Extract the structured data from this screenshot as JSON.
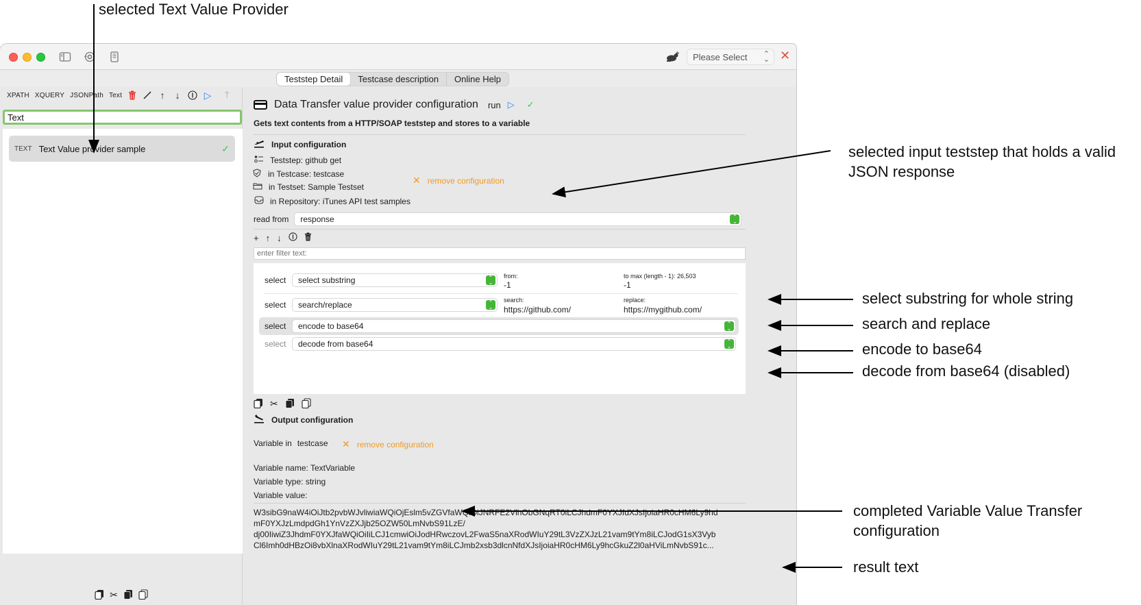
{
  "annotations": {
    "top_label": "selected Text Value Provider",
    "input_teststep": [
      "selected input teststep that holds a valid",
      "JSON response"
    ],
    "substring": "select substring for  whole string",
    "search_replace": "search and replace",
    "encode": "encode to base64",
    "decode": "decode from base64 (disabled)",
    "completed": [
      "completed Variable Value Transfer",
      "configuration"
    ],
    "result": "result text"
  },
  "window": {
    "toolbar_icons": [
      "sidebar-toggle-icon",
      "sync-settings-icon",
      "notes-icon"
    ],
    "environment_select": {
      "value": "Please Select"
    },
    "close_label": "✕"
  },
  "tabs": [
    {
      "label": "Teststep Detail",
      "active": true
    },
    {
      "label": "Testcase description",
      "active": false
    },
    {
      "label": "Online Help",
      "active": false
    }
  ],
  "sidebar": {
    "toolbar": {
      "types": [
        "XPATH",
        "XQUERY",
        "JSONPath",
        "Text"
      ],
      "icons": [
        "trash-icon",
        "edit-icon",
        "arrow-up-icon",
        "arrow-down-icon",
        "info-icon",
        "play-icon",
        "pin-icon"
      ]
    },
    "filter_value": "Text",
    "items": [
      {
        "kind": "TEXT",
        "name": "Text Value provider sample",
        "status": "✓"
      }
    ],
    "bottom_icons": [
      "copy-icon",
      "cut-icon",
      "paste-icon",
      "duplicate-icon"
    ]
  },
  "main": {
    "title": "Data Transfer value provider configuration",
    "run_label": "run",
    "play_glyph": "▷",
    "status_glyph": "✓",
    "subtitle": "Gets text contents from a HTTP/SOAP teststep and stores to a variable",
    "input_section": {
      "heading": "Input configuration",
      "teststep": "Teststep: github get",
      "testcase": "in Testcase: testcase",
      "testset": "in Testset: Sample Testset",
      "repository": "in Repository: iTunes API test samples",
      "remove_label": "remove configuration"
    },
    "read_from": {
      "label": "read from",
      "value": "response"
    },
    "filter_placeholder": "enter filter text:",
    "operations": [
      {
        "label": "select",
        "value": "select substring",
        "field1_label": "from:",
        "field1_value": "-1",
        "field2_label": "to max (length - 1): 26,503",
        "field2_value": "-1",
        "disabled": false
      },
      {
        "label": "select",
        "value": "search/replace",
        "field1_label": "search:",
        "field1_value": "https://github.com/",
        "field2_label": "replace:",
        "field2_value": "https://mygithub.com/",
        "disabled": false
      },
      {
        "label": "select",
        "value": "encode to base64",
        "disabled": false,
        "selected": true
      },
      {
        "label": "select",
        "value": "decode from base64",
        "disabled": true
      }
    ],
    "output_section": {
      "heading": "Output configuration",
      "variable_in_label": "Variable in",
      "variable_in_value": "testcase",
      "remove_label": "remove configuration",
      "variable_name": "Variable name: TextVariable",
      "variable_type": "Variable type: string",
      "variable_value_label": "Variable value:",
      "result_lines": [
        "W3sibG9naW4iOiJtb2pvbWJvliwiaWQiOjEslm5vZGVfaWQiOiJNRFE2VlhObGNqRT0iLCJhdmF0YXJfdXJsIjoiaHR0cHM6Ly9hd",
        "mF0YXJzLmdpdGh1YnVzZXJjb25OZW50LmNvbS91LzE/",
        "dj00IiwiZ3JhdmF0YXJfaWQiOiIiLCJ1cmwiOiJodHRwczovL2FwaS5naXRodWIuY29tL3VzZXJzL21vam9tYm8iLCJodG1sX3Vyb",
        "Cl6Imh0dHBzOi8vbXlnaXRodWIuY29tL21vam9tYm8iLCJmb2xsb3dlcnNfdXJsIjoiaHR0cHM6Ly9hcGkuZ2l0aHViLmNvbS91c..."
      ]
    }
  }
}
